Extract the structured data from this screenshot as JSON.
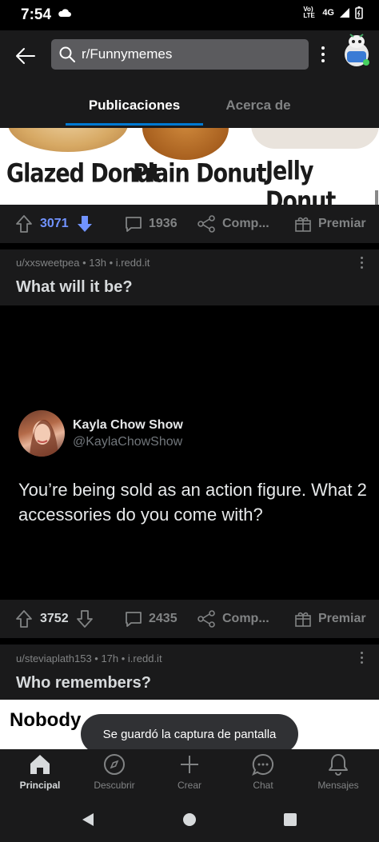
{
  "status_bar": {
    "time": "7:54",
    "network_label": "Vo) LTE",
    "signal_label": "4G"
  },
  "header": {
    "search_text": "r/Funnymemes",
    "tabs": [
      {
        "label": "Publicaciones",
        "active": true
      },
      {
        "label": "Acerca de",
        "active": false
      }
    ]
  },
  "image_strip": {
    "labels": [
      "Glazed Donut",
      "Plain Donut",
      "Jelly Donut"
    ]
  },
  "post1_actions": {
    "votes": "3071",
    "upvoted": true,
    "comments": "1936",
    "share_label": "Comp...",
    "award_label": "Premiar"
  },
  "post2": {
    "meta": "u/xxsweetpea • 13h • i.redd.it",
    "title": "What will it be?",
    "tweet": {
      "name": "Kayla Chow Show",
      "handle": "@KaylaChowShow",
      "text": "You’re being sold as an action figure. What 2 accessories do you come with?"
    },
    "actions": {
      "votes": "3752",
      "comments": "2435",
      "share_label": "Comp...",
      "award_label": "Premiar"
    }
  },
  "post3": {
    "meta": "u/steviaplath153 • 17h • i.redd.it",
    "title": "Who remembers?",
    "image_text": "Nobody"
  },
  "toast": {
    "text": "Se guardó la captura de pantalla"
  },
  "bottom_nav": [
    {
      "label": "Principal",
      "icon": "home-icon",
      "active": true
    },
    {
      "label": "Descubrir",
      "icon": "compass-icon",
      "active": false
    },
    {
      "label": "Crear",
      "icon": "plus-icon",
      "active": false
    },
    {
      "label": "Chat",
      "icon": "chat-icon",
      "active": false
    },
    {
      "label": "Mensajes",
      "icon": "bell-icon",
      "active": false
    }
  ],
  "colors": {
    "accent": "#0079d3",
    "upvote": "#7193ff",
    "surface": "#1a1a1b"
  }
}
